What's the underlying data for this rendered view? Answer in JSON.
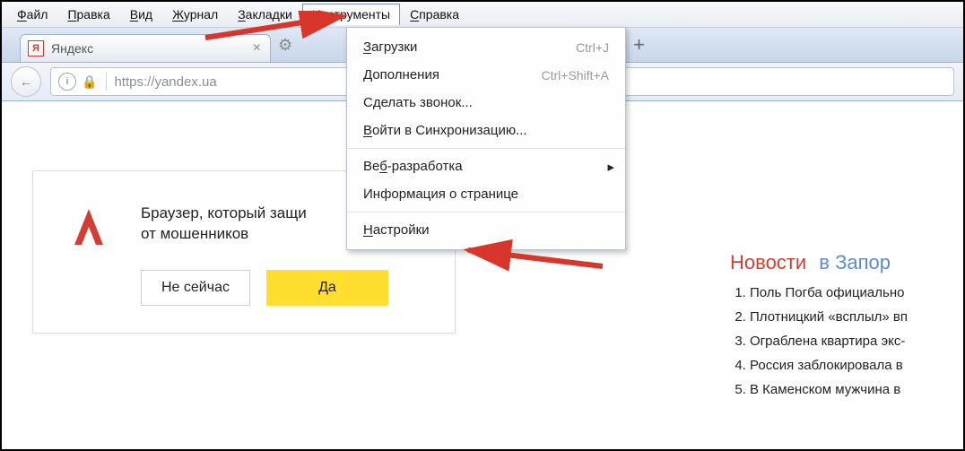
{
  "menubar": {
    "items": [
      {
        "first": "Ф",
        "rest": "айл"
      },
      {
        "first": "П",
        "rest": "равка"
      },
      {
        "first": "В",
        "rest": "ид"
      },
      {
        "first": "Ж",
        "rest": "урнал"
      },
      {
        "first": "З",
        "rest": "акладки"
      },
      {
        "first": "И",
        "rest": "нструменты"
      },
      {
        "first": "С",
        "rest": "правка"
      }
    ],
    "selected_index": 5
  },
  "tab": {
    "favicon_letter": "Я",
    "title": "Яндекс",
    "close_glyph": "×",
    "gear_glyph": "⚙",
    "plus_glyph": "+"
  },
  "urlbar": {
    "back_glyph": "←",
    "info_glyph": "i",
    "lock_glyph": "🔒",
    "url": "https://yandex.ua"
  },
  "dropdown": {
    "items": [
      {
        "type": "item",
        "ul": "З",
        "rest": "агрузки",
        "shortcut": "Ctrl+J"
      },
      {
        "type": "item",
        "ul": "Д",
        "rest": "ополнения",
        "shortcut": "Ctrl+Shift+A"
      },
      {
        "type": "item",
        "label": "Сделать звонок..."
      },
      {
        "type": "item",
        "ul": "В",
        "rest": "ойти в Синхронизацию..."
      },
      {
        "type": "sep"
      },
      {
        "type": "item",
        "ul_mid_pre": "Ве",
        "ul": "б",
        "rest": "-разработка",
        "submenu": true
      },
      {
        "type": "item",
        "label": "Информация о странице"
      },
      {
        "type": "sep"
      },
      {
        "type": "item",
        "ul": "Н",
        "rest": "астройки"
      }
    ]
  },
  "card": {
    "line1": "Браузер, который защи",
    "line2": "от мошенников",
    "btn_no": "Не сейчас",
    "btn_yes": "Да"
  },
  "news": {
    "head_a": "Новости",
    "head_b": "в Запор",
    "items": [
      "Поль Погба официально",
      "Плотницкий «всплыл» вп",
      "Ограблена квартира экс-",
      "Россия заблокировала в",
      "В Каменском мужчина в"
    ]
  }
}
